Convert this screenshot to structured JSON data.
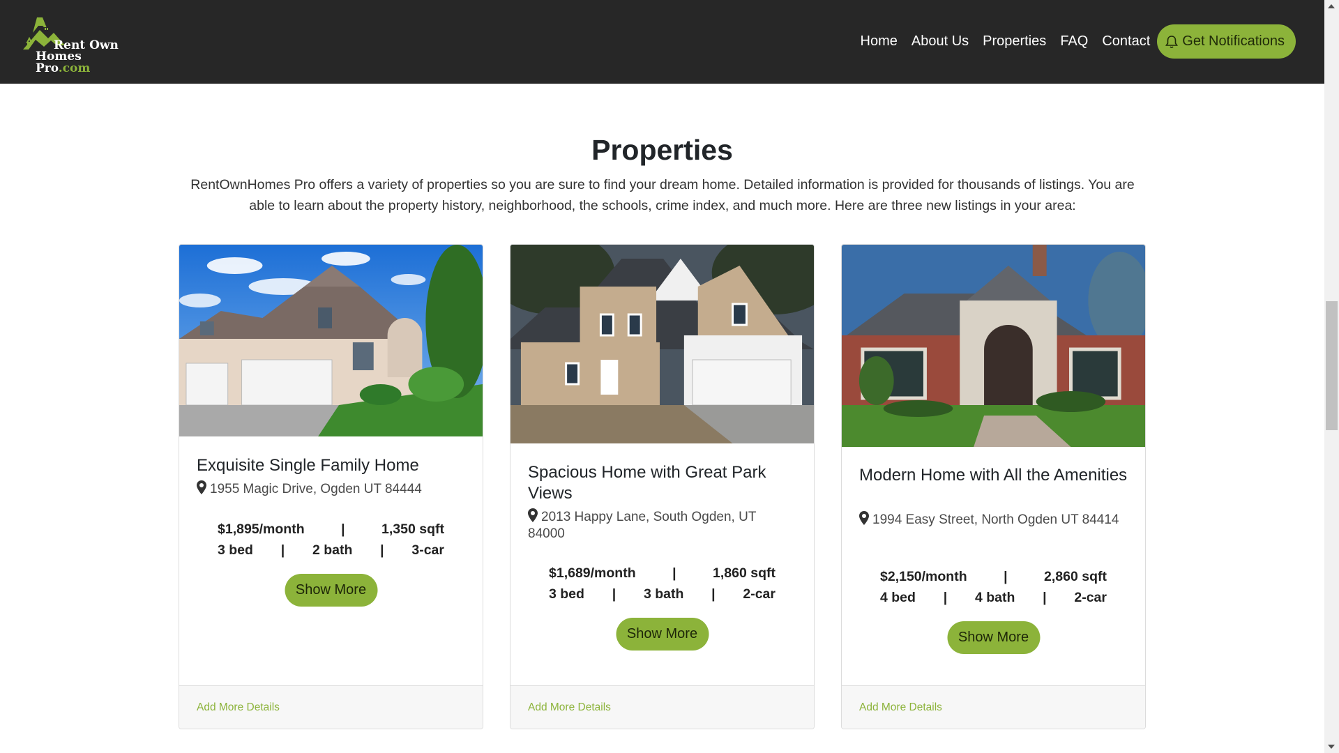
{
  "brand": {
    "line1": "Rent Own",
    "line2_main": "Homes Pro",
    "line2_suffix": ".com",
    "accent_color": "#8cb33a",
    "nav_bg": "#272727"
  },
  "nav": {
    "links": [
      "Home",
      "About Us",
      "Properties",
      "FAQ",
      "Contact"
    ],
    "notify_label": "Get Notifications",
    "notify_icon": "bell-icon"
  },
  "section": {
    "title": "Properties",
    "intro": "RentOwnHomes Pro offers a variety of properties so you are sure to find your dream home. Detailed information is provided for thousands of listings. You are able to learn about the property history, neighborhood, the schools, crime index, and much more. Here are three new listings in your area:"
  },
  "cards": [
    {
      "title": "Exquisite Single Family Home",
      "address": "1955 Magic Drive, Ogden UT 84444",
      "price": "$1,895/month",
      "sqft": "1,350 sqft",
      "beds": "3 bed",
      "baths": "2 bath",
      "garage": "3-car",
      "separator": "|",
      "button": "Show More",
      "footer_link": "Add More Details"
    },
    {
      "title": "Spacious Home with Great Park Views",
      "address": "2013 Happy Lane, South Ogden, UT 84000",
      "price": "$1,689/month",
      "sqft": "1,860 sqft",
      "beds": "3 bed",
      "baths": "3 bath",
      "garage": "2-car",
      "separator": "|",
      "button": "Show More",
      "footer_link": "Add More Details"
    },
    {
      "title": "Modern Home with All the Amenities",
      "address": "1994 Easy Street, North Ogden UT 84414",
      "price": "$2,150/month",
      "sqft": "2,860 sqft",
      "beds": "4 bed",
      "baths": "4 bath",
      "garage": "2-car",
      "separator": "|",
      "button": "Show More",
      "footer_link": "Add More Details"
    }
  ]
}
